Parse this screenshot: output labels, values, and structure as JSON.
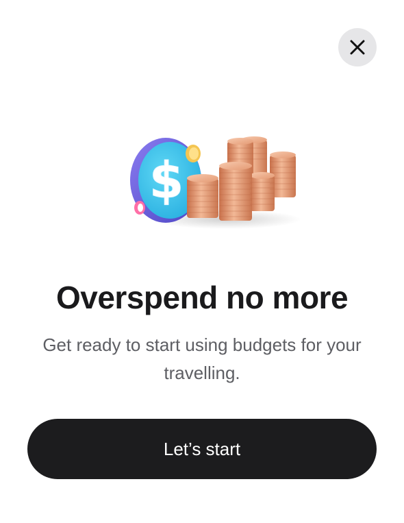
{
  "dialog": {
    "close_icon": "close-icon",
    "illustration_icon": "dollar-coins-illustration",
    "title": "Overspend no more",
    "subtitle": "Get ready to start using budgets for your travelling.",
    "primary_button_label": "Let’s start"
  },
  "colors": {
    "background": "#ffffff",
    "close_button_bg": "#e6e6e8",
    "title": "#1a1a1c",
    "subtitle": "#5d5e63",
    "button_bg": "#1c1c1e",
    "button_text": "#ffffff",
    "coin_face": "#3dc3e8",
    "coin_rim": "#6b63d9",
    "stack_copper": "#e8a07a"
  }
}
